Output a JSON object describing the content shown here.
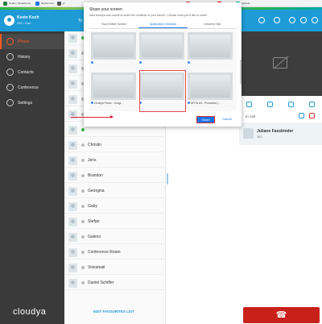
{
  "bookmarks": [
    {
      "label": "Duden | Sprache ka...",
      "color": "#2d7d46"
    },
    {
      "label": "skyrtke.com",
      "color": "#1a73e8"
    },
    {
      "label": "pr",
      "color": "#555555"
    },
    {
      "label": "Technical Documen...",
      "color": "#d33333"
    },
    {
      "label": "YouTube",
      "color": "#ff0000"
    },
    {
      "label": "Intranet",
      "color": "#0aa"
    }
  ],
  "user": {
    "name": "Kevin Koch",
    "ext": "392 - Kan"
  },
  "nav": [
    {
      "label": "Phone",
      "active": true
    },
    {
      "label": "History",
      "active": false
    },
    {
      "label": "Contacts",
      "active": false
    },
    {
      "label": "Conference",
      "active": false
    },
    {
      "label": "Settings",
      "active": false
    }
  ],
  "brand": "cloudya",
  "contacts_header": "To",
  "contacts": [
    {
      "name": "",
      "status": "green"
    },
    {
      "name": "",
      "status": "grey"
    },
    {
      "name": "",
      "status": "grey"
    },
    {
      "name": "",
      "status": "grey"
    },
    {
      "name": "",
      "status": "grey"
    },
    {
      "name": "",
      "status": "grey"
    },
    {
      "name": "",
      "status": "green"
    },
    {
      "name": "Christin",
      "status": "grey"
    },
    {
      "name": "Jens",
      "status": "grey"
    },
    {
      "name": "Brandon",
      "status": "grey"
    },
    {
      "name": "Georgina",
      "status": "grey"
    },
    {
      "name": "Gaby",
      "status": "grey"
    },
    {
      "name": "Stefan",
      "status": "grey"
    },
    {
      "name": "Galeno",
      "status": "grey"
    },
    {
      "name": "Conference Room",
      "status": "grey"
    },
    {
      "name": "Voicemail",
      "status": "grey"
    },
    {
      "name": "Daniel Schiffer",
      "status": "grey"
    }
  ],
  "edit_favourites": "EDIT FAVOURITES LIST",
  "dialog": {
    "title": "Share your screen",
    "subtitle": "start.cloudya.com wants to share the contents of your screen. Choose what you'd like to share.",
    "tabs": [
      "Your Entire Screen",
      "Application Window",
      "Chrome Tab"
    ],
    "active_tab": 1,
    "windows": [
      {
        "caption": ""
      },
      {
        "caption": ""
      },
      {
        "caption": ""
      },
      {
        "caption": "Cloudya Phone - Googl..."
      },
      {
        "caption": ""
      },
      {
        "caption": "NFON AG - Production |..."
      },
      {
        "caption": ""
      },
      {
        "caption": ""
      },
      {
        "caption": ""
      }
    ],
    "share_label": "Share",
    "cancel_label": "Cancel"
  },
  "call": {
    "in_call_label": "In call",
    "partner_name": "Juliane Fassbinder",
    "partner_number": "383"
  },
  "colors": {
    "accent": "#1e9bd7",
    "sidebar": "#3a3a3a",
    "active": "#ff5a1f",
    "hangup": "#c8211a",
    "share": "#1a73e8"
  }
}
